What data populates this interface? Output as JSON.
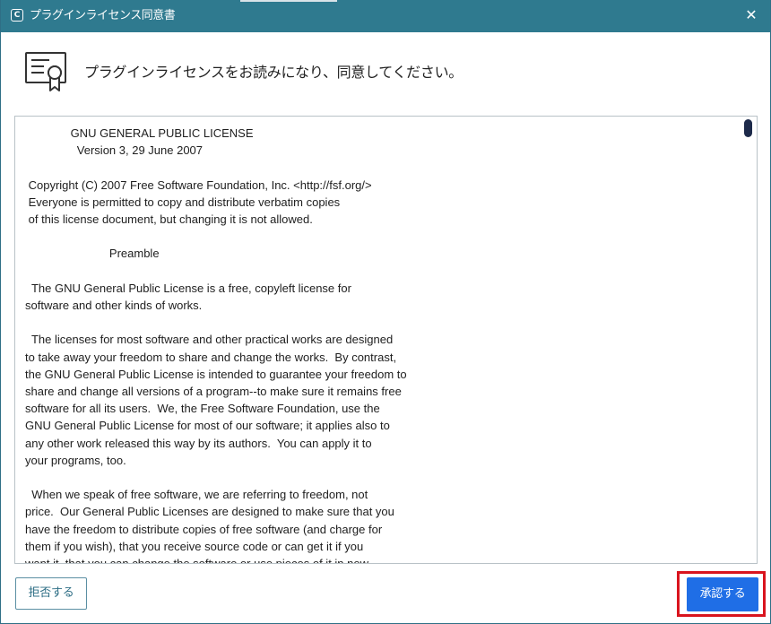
{
  "window": {
    "title": "プラグインライセンス同意書",
    "app_icon_letter": "C",
    "close_symbol": "✕"
  },
  "header": {
    "icon": "certificate-icon",
    "heading": "プラグインライセンスをお読みになり、同意してください。"
  },
  "license": {
    "text": "              GNU GENERAL PUBLIC LICENSE\n                Version 3, 29 June 2007\n\n Copyright (C) 2007 Free Software Foundation, Inc. <http://fsf.org/>\n Everyone is permitted to copy and distribute verbatim copies\n of this license document, but changing it is not allowed.\n\n                          Preamble\n\n  The GNU General Public License is a free, copyleft license for\nsoftware and other kinds of works.\n\n  The licenses for most software and other practical works are designed\nto take away your freedom to share and change the works.  By contrast,\nthe GNU General Public License is intended to guarantee your freedom to\nshare and change all versions of a program--to make sure it remains free\nsoftware for all its users.  We, the Free Software Foundation, use the\nGNU General Public License for most of our software; it applies also to\nany other work released this way by its authors.  You can apply it to\nyour programs, too.\n\n  When we speak of free software, we are referring to freedom, not\nprice.  Our General Public Licenses are designed to make sure that you\nhave the freedom to distribute copies of free software (and charge for\nthem if you wish), that you receive source code or can get it if you\nwant it, that you can change the software or use pieces of it in new"
  },
  "buttons": {
    "decline_label": "拒否する",
    "accept_label": "承認する"
  },
  "colors": {
    "titlebar": "#2f7a8f",
    "accept_button": "#1f6ee6",
    "highlight": "#d9141e",
    "scroll_thumb": "#1d2a4a"
  }
}
